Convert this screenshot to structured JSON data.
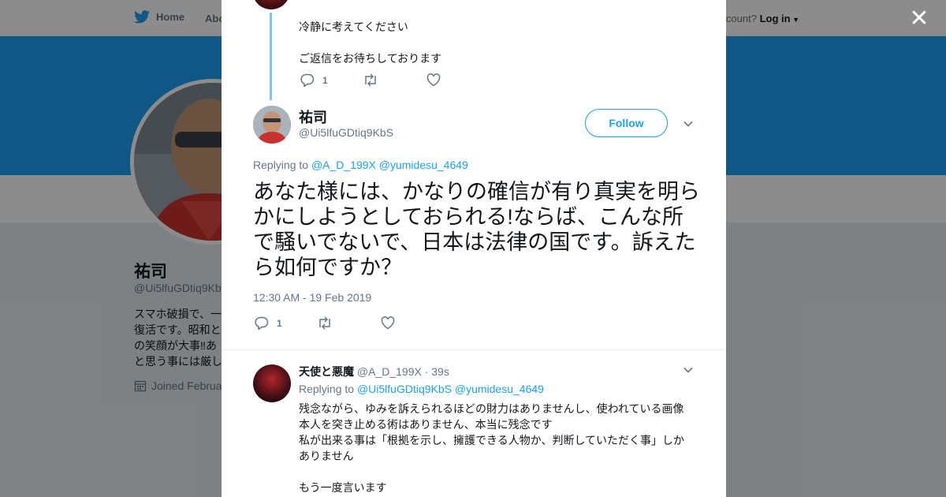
{
  "nav": {
    "home_label": "Home",
    "about_label": "Abo",
    "account_text": "ccount?",
    "login_label": "Log in"
  },
  "background_profile": {
    "name": "祐司",
    "handle": "@Ui5lfuGDtiq9Kb",
    "bio_lines": [
      "スマホ破損で、一",
      "復活です。昭和と",
      "の笑顔が大事‼あ",
      "と思う事には厳し"
    ],
    "joined": "Joined Februa"
  },
  "previous_tweet": {
    "line1": "冷静に考えてください",
    "line2": "ご返信をお待ちしております",
    "reply_count": "1"
  },
  "main_tweet": {
    "author_name": "祐司",
    "author_handle": "@Ui5lfuGDtiq9KbS",
    "follow_label": "Follow",
    "replying_to_label": "Replying to",
    "mention_1": "@A_D_199X",
    "mention_2": "@yumidesu_4649",
    "text": "あなた様には、かなりの確信が有り真実を明らかにしようとしておられる!ならば、こんな所で騒いでないで、日本は法律の国です。訴えたら如何ですか？",
    "timestamp": "12:30 AM - 19 Feb 2019",
    "reply_count": "1"
  },
  "reply_tweet": {
    "author_name": "天使と悪魔",
    "author_handle": "@A_D_199X",
    "time": "· 39s",
    "replying_to_label": "Replying to",
    "mention_1": "@Ui5lfuGDtiq9KbS",
    "mention_2": "@yumidesu_4649",
    "line1": "残念ながら、ゆみを訴えられるほどの財力はありませんし、使われている画像本人を突き止める術はありません、本当に残念です",
    "line2": "私が出来る事は「根拠を示し、擁護できる人物か、判断していただく事」しかありません",
    "line3": "もう一度言います"
  },
  "colors": {
    "accent": "#1da1f2",
    "thread_line": "#84c5ee",
    "muted": "#657786"
  }
}
